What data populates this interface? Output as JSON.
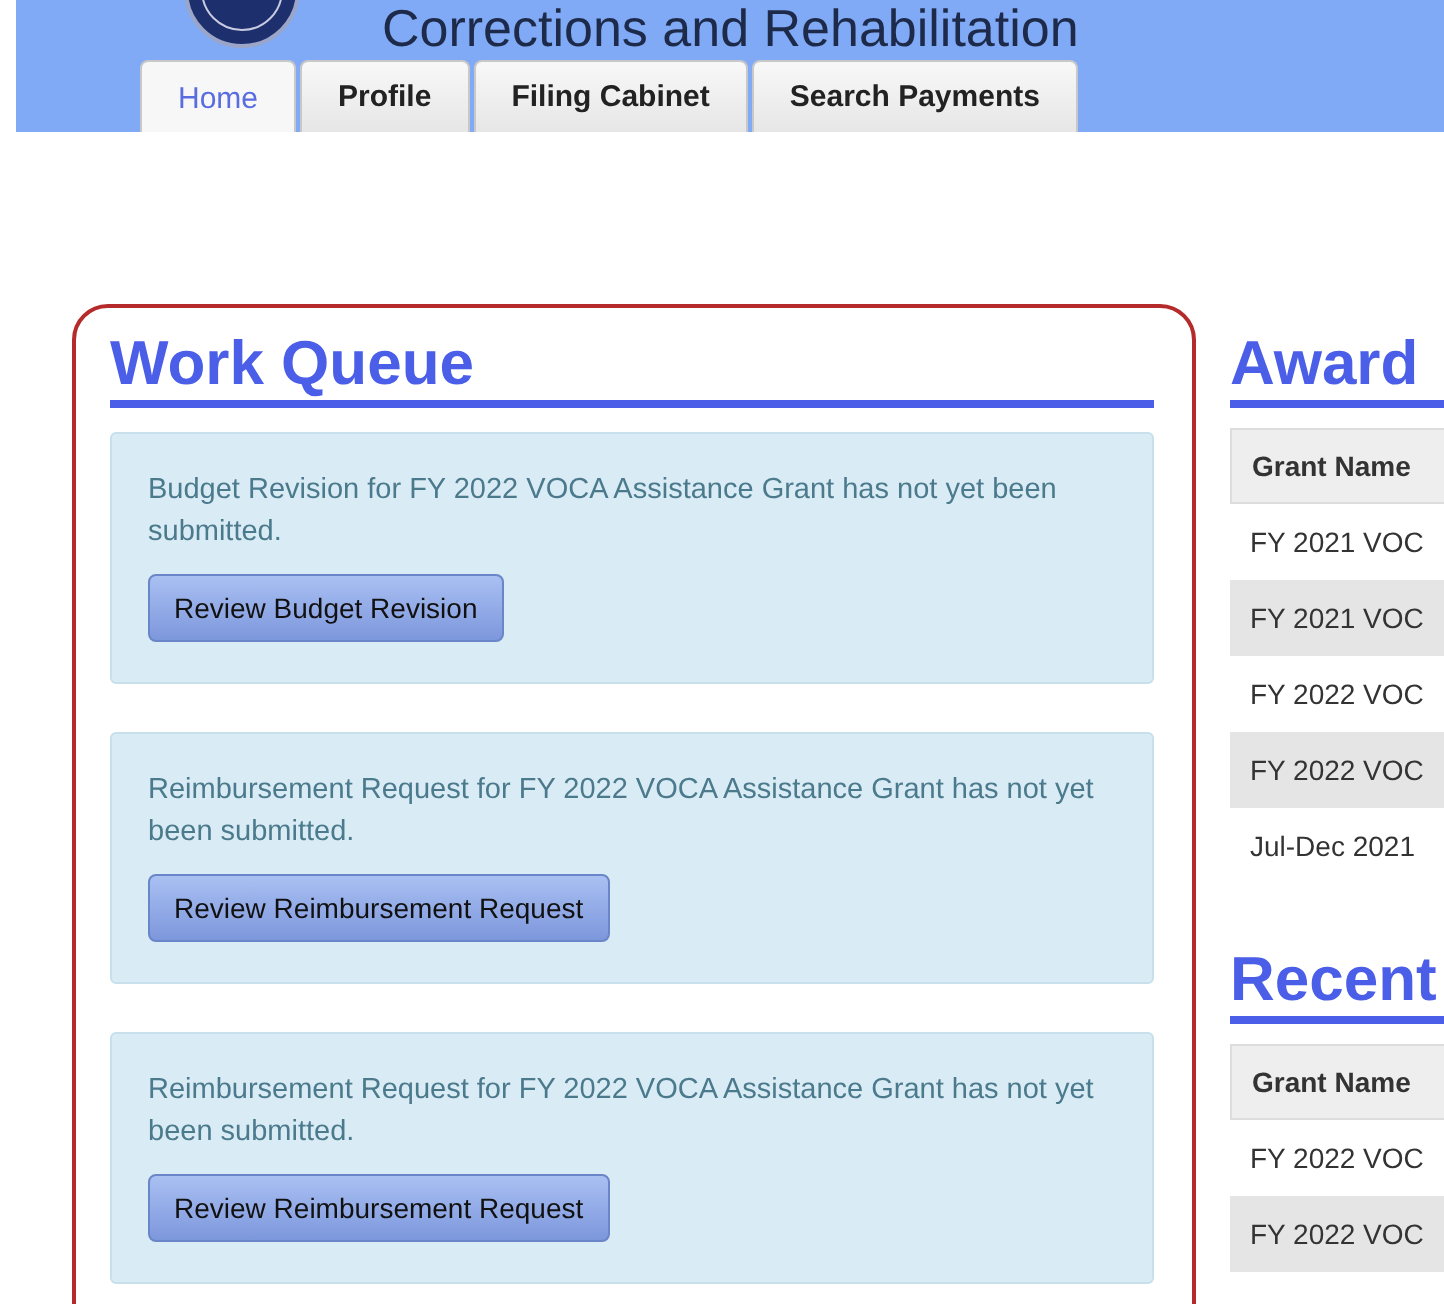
{
  "header": {
    "title": "Corrections and Rehabilitation"
  },
  "tabs": [
    {
      "label": "Home",
      "selected": true
    },
    {
      "label": "Profile",
      "selected": false
    },
    {
      "label": "Filing Cabinet",
      "selected": false
    },
    {
      "label": "Search Payments",
      "selected": false
    }
  ],
  "work_queue": {
    "title": "Work Queue",
    "items": [
      {
        "message": "Budget Revision for FY 2022 VOCA Assistance Grant has not yet been submitted.",
        "button": "Review Budget Revision"
      },
      {
        "message": "Reimbursement Request for FY 2022 VOCA Assistance Grant has not yet been submitted.",
        "button": "Review Reimbursement Request"
      },
      {
        "message": "Reimbursement Request for FY 2022 VOCA Assistance Grant has not yet been submitted.",
        "button": "Review Reimbursement Request"
      }
    ]
  },
  "awards": {
    "title": "Award",
    "columns": [
      "Grant Name"
    ],
    "rows": [
      "FY 2021 VOC",
      "FY 2021 VOC",
      "FY 2022 VOC",
      "FY 2022 VOC",
      "Jul-Dec 2021"
    ]
  },
  "recent": {
    "title": "Recent",
    "columns": [
      "Grant Name"
    ],
    "rows": [
      "FY 2022 VOC",
      "FY 2022 VOC"
    ]
  }
}
